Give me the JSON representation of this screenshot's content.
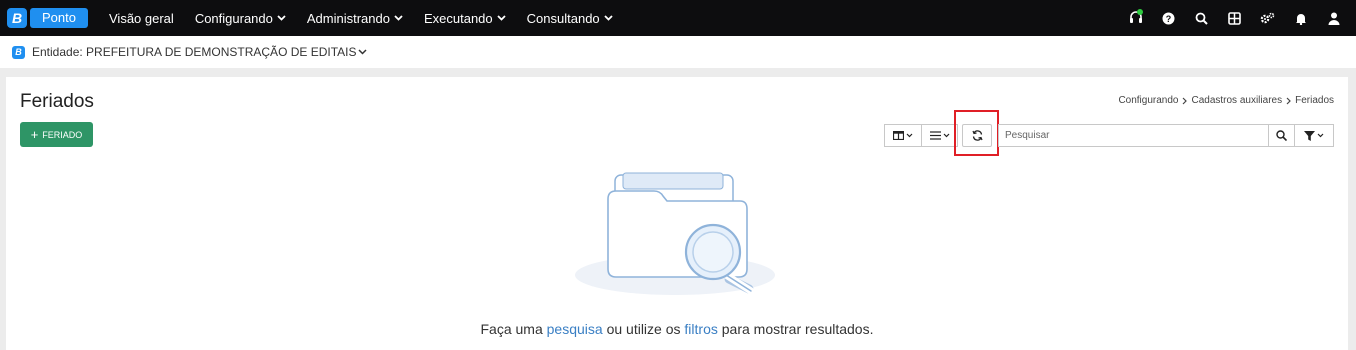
{
  "brand": {
    "letter": "B",
    "name": "Ponto"
  },
  "nav": {
    "items": [
      {
        "label": "Visão geral",
        "dropdown": false
      },
      {
        "label": "Configurando",
        "dropdown": true
      },
      {
        "label": "Administrando",
        "dropdown": true
      },
      {
        "label": "Executando",
        "dropdown": true
      },
      {
        "label": "Consultando",
        "dropdown": true
      }
    ]
  },
  "top_icons": [
    "headset-icon",
    "help-icon",
    "search-icon",
    "apps-grid-icon",
    "settings-icon",
    "bell-icon",
    "user-icon"
  ],
  "entity": {
    "letter": "B",
    "label": "Entidade: PREFEITURA DE DEMONSTRAÇÃO DE EDITAIS"
  },
  "page": {
    "title": "Feriados",
    "breadcrumb": [
      "Configurando",
      "Cadastros auxiliares",
      "Feriados"
    ],
    "add_button": "FERIADO"
  },
  "toolbar": {
    "search_placeholder": "Pesquisar",
    "buttons": [
      "columns-icon",
      "list-icon",
      "refresh-icon",
      "search-icon",
      "filter-icon"
    ]
  },
  "empty_state": {
    "prefix": "Faça uma",
    "link1": "pesquisa",
    "middle": "ou utilize os",
    "link2": "filtros",
    "suffix": "para mostrar resultados."
  },
  "colors": {
    "brand": "#1f8ff0",
    "primary_button": "#2e9566",
    "highlight": "#e01f26",
    "link": "#3a7fc4",
    "topbar": "#0d0d0f"
  }
}
